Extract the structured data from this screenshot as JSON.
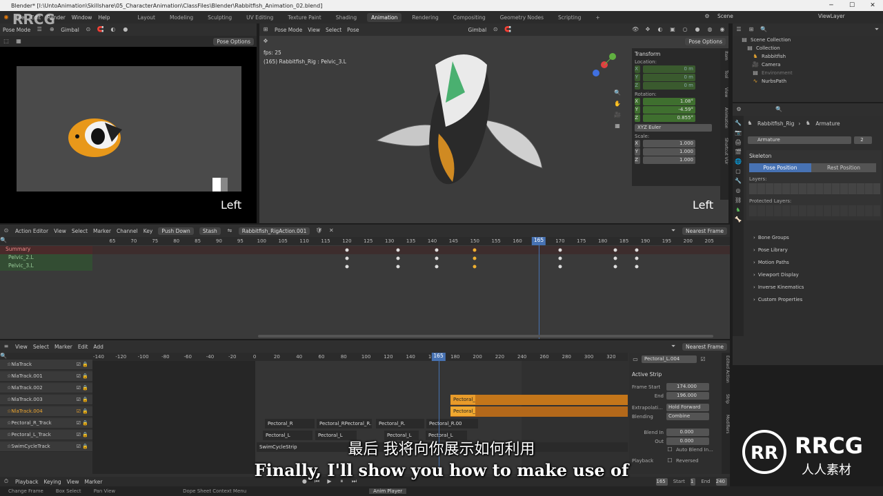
{
  "window": {
    "title": "Blender* [I:\\UntoAnimation\\Skillshare\\05_CharacterAnimation\\ClassFiles\\Blender\\Rabbitfish_Animation_02.blend]"
  },
  "menu": [
    "File",
    "Edit",
    "Render",
    "Window",
    "Help"
  ],
  "workspaces": [
    "Layout",
    "Modeling",
    "Sculpting",
    "UV Editing",
    "Texture Paint",
    "Shading",
    "Animation",
    "Rendering",
    "Compositing",
    "Geometry Nodes",
    "Scripting"
  ],
  "active_workspace": "Animation",
  "scene": {
    "name": "Scene",
    "view_layer": "ViewLayer"
  },
  "camera_view": {
    "mode": "Pose Mode",
    "orientation": "Gimbal",
    "pose_options": "Pose Options",
    "label": "Left"
  },
  "viewport": {
    "mode": "Pose Mode",
    "menus": [
      "View",
      "Select",
      "Pose"
    ],
    "orientation": "Gimbal",
    "fps": "fps: 25",
    "info": "(165) Rabbitfish_Rig : Pelvic_3.L",
    "label": "Left",
    "pose_options": "Pose Options",
    "transform": {
      "title": "Transform",
      "location_label": "Location:",
      "rotation_label": "Rotation:",
      "scale_label": "Scale:",
      "location": [
        {
          "axis": "X",
          "value": "0 m"
        },
        {
          "axis": "Y",
          "value": "0 m"
        },
        {
          "axis": "Z",
          "value": "0 m"
        }
      ],
      "rotation": [
        {
          "axis": "X",
          "value": "1.08°"
        },
        {
          "axis": "Y",
          "value": "-4.59°"
        },
        {
          "axis": "Z",
          "value": "0.855°"
        }
      ],
      "rotation_mode": "XYZ Euler",
      "scale": [
        {
          "axis": "X",
          "value": "1.000"
        },
        {
          "axis": "Y",
          "value": "1.000"
        },
        {
          "axis": "Z",
          "value": "1.000"
        }
      ]
    },
    "side_tabs": [
      "Item",
      "Tool",
      "View",
      "Animation",
      "Shortcut VUr"
    ]
  },
  "outliner": {
    "items": [
      {
        "name": "Scene Collection",
        "indent": 0
      },
      {
        "name": "Collection",
        "indent": 1
      },
      {
        "name": "Rabbitfish",
        "indent": 2
      },
      {
        "name": "Camera",
        "indent": 2
      },
      {
        "name": "Environment",
        "indent": 2
      },
      {
        "name": "NurbsPath",
        "indent": 2
      }
    ]
  },
  "properties": {
    "breadcrumb_object": "Rabbitfish_Rig",
    "breadcrumb_data": "Armature",
    "data_name": "Armature",
    "users": "2",
    "skeleton_title": "Skeleton",
    "pose_position": "Pose Position",
    "rest_position": "Rest Position",
    "layers_label": "Layers:",
    "protected_layers_label": "Protected Layers:",
    "sections": [
      "Bone Groups",
      "Pose Library",
      "Motion Paths",
      "Viewport Display",
      "Inverse Kinematics",
      "Custom Properties"
    ]
  },
  "action_editor": {
    "mode": "Action Editor",
    "menus": [
      "View",
      "Select",
      "Marker",
      "Channel",
      "Key"
    ],
    "push_down": "Push Down",
    "stash": "Stash",
    "action": "Rabbitfish_RigAction.001",
    "snapping": "Nearest Frame",
    "current_frame": "165",
    "ticks": [
      "65",
      "70",
      "75",
      "80",
      "85",
      "90",
      "95",
      "100",
      "105",
      "110",
      "115",
      "120",
      "125",
      "130",
      "135",
      "140",
      "145",
      "150",
      "155",
      "160",
      "165",
      "170",
      "175",
      "180",
      "185",
      "190",
      "195",
      "200",
      "205"
    ],
    "channels": [
      "Summary",
      "Pelvic_2.L",
      "Pelvic_3.L"
    ],
    "keyframes": [
      120,
      132,
      141,
      150,
      170,
      183,
      188
    ]
  },
  "nla_editor": {
    "menus": [
      "View",
      "Select",
      "Marker",
      "Edit",
      "Add"
    ],
    "snapping": "Nearest Frame",
    "current_frame": "165",
    "ticks": [
      "-140",
      "-120",
      "-100",
      "-80",
      "-60",
      "-40",
      "-20",
      "0",
      "20",
      "40",
      "60",
      "80",
      "100",
      "120",
      "140",
      "160",
      "180",
      "200",
      "220",
      "240",
      "260",
      "280",
      "300",
      "320"
    ],
    "tracks": [
      "NlaTrack",
      "NlaTrack.001",
      "NlaTrack.002",
      "NlaTrack.003",
      "NlaTrack.004",
      "Pectoral_R_Track",
      "Pectoral_L_Track",
      "SwimCycleTrack"
    ],
    "strips": [
      "Pectoral_R.",
      "Pectoral_L",
      "Pectoral_R",
      "Pectoral_RPectoral_R.",
      "Pectoral_R.",
      "Pectoral_R.00",
      "Pectoral_L",
      "Pectoral_L",
      "Pectoral_L",
      "Pectoral_L",
      "SwimCycleStrip"
    ],
    "sidebar": {
      "strip_name": "Pectoral_L.004",
      "active_strip": "Active Strip",
      "frame_start_label": "Frame Start",
      "frame_start": "174.000",
      "end_label": "End",
      "end": "196.000",
      "extrapolation_label": "Extrapolati...",
      "extrapolation": "Hold Forward",
      "blending_label": "Blending",
      "blending": "Combine",
      "blend_in_label": "Blend In",
      "blend_in": "0.000",
      "out_label": "Out",
      "out": "0.000",
      "auto_blend": "Auto Blend In...",
      "playback_label": "Playback",
      "reversed": "Reversed",
      "tabs": [
        "Edited Action",
        "Strip",
        "Modifiers"
      ]
    }
  },
  "timeline": {
    "menus": [
      "Playback",
      "Keying",
      "View",
      "Marker"
    ],
    "frame": "165",
    "start_label": "Start",
    "start": "1",
    "end_label": "End",
    "end": "240"
  },
  "statusbar": {
    "items": [
      "Change Frame",
      "Box Select",
      "Pan View",
      "Dope Sheet Context Menu",
      "Anim Player"
    ]
  },
  "subtitles": {
    "cn": "最后 我将向你展示如何利用",
    "en": "Finally, I'll show you how to make use of"
  },
  "watermarks": {
    "logo": "RRCG",
    "logo_sub": "人人素材"
  }
}
